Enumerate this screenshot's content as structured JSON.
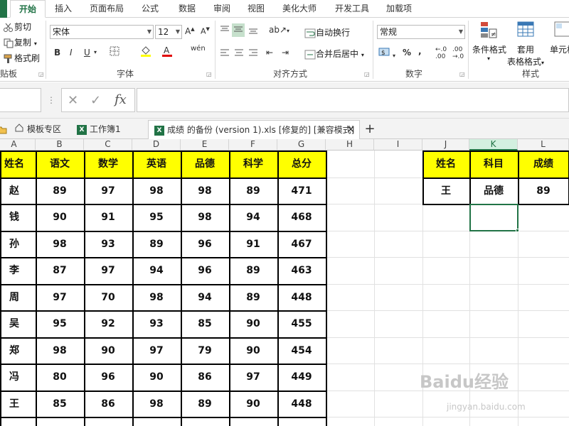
{
  "ribbon_tabs": [
    "开始",
    "插入",
    "页面布局",
    "公式",
    "数据",
    "审阅",
    "视图",
    "美化大师",
    "开发工具",
    "加载项"
  ],
  "clipboard": {
    "cut": "剪切",
    "copy": "复制",
    "format_painter": "格式刷",
    "label": "贴板"
  },
  "font": {
    "name": "宋体",
    "size": "12",
    "label": "字体",
    "bold": "B",
    "italic": "I",
    "underline": "U"
  },
  "alignment": {
    "wrap": "自动换行",
    "merge": "合并后居中",
    "label": "对齐方式"
  },
  "number": {
    "format": "常规",
    "percent": "%",
    "comma": ",",
    "label": "数字"
  },
  "styles": {
    "conditional": "条件格式",
    "table_l1": "套用",
    "table_l2": "表格格式",
    "cell": "单元格",
    "label": "样式"
  },
  "formula_bar": {
    "fx": "fx",
    "cancel": "✕",
    "enter": "✓"
  },
  "doc_tabs": [
    {
      "label": "模板专区"
    },
    {
      "label": "工作簿1"
    },
    {
      "label": "成绩 的备份 (version 1).xls [修复的] [兼容模式]"
    }
  ],
  "columns": [
    "A",
    "B",
    "C",
    "D",
    "E",
    "F",
    "G",
    "H",
    "I",
    "J",
    "K",
    "L"
  ],
  "table": {
    "headers": [
      "姓名",
      "语文",
      "数学",
      "英语",
      "品德",
      "科学",
      "总分"
    ],
    "rows": [
      [
        "赵",
        "89",
        "97",
        "98",
        "98",
        "89",
        "471"
      ],
      [
        "钱",
        "90",
        "91",
        "95",
        "98",
        "94",
        "468"
      ],
      [
        "孙",
        "98",
        "93",
        "89",
        "96",
        "91",
        "467"
      ],
      [
        "李",
        "87",
        "97",
        "94",
        "96",
        "89",
        "463"
      ],
      [
        "周",
        "97",
        "70",
        "98",
        "94",
        "89",
        "448"
      ],
      [
        "吴",
        "95",
        "92",
        "93",
        "85",
        "90",
        "455"
      ],
      [
        "郑",
        "98",
        "90",
        "97",
        "79",
        "90",
        "454"
      ],
      [
        "冯",
        "80",
        "96",
        "90",
        "86",
        "97",
        "449"
      ],
      [
        "王",
        "85",
        "86",
        "98",
        "89",
        "90",
        "448"
      ]
    ]
  },
  "lookup": {
    "headers": [
      "姓名",
      "科目",
      "成绩"
    ],
    "row": [
      "王",
      "品德",
      "89"
    ]
  },
  "watermark": {
    "main": "Baidu经验",
    "sub": "jingyan.baidu.com"
  },
  "colors": {
    "header_fill": "#ffff00",
    "accent": "#217346"
  }
}
